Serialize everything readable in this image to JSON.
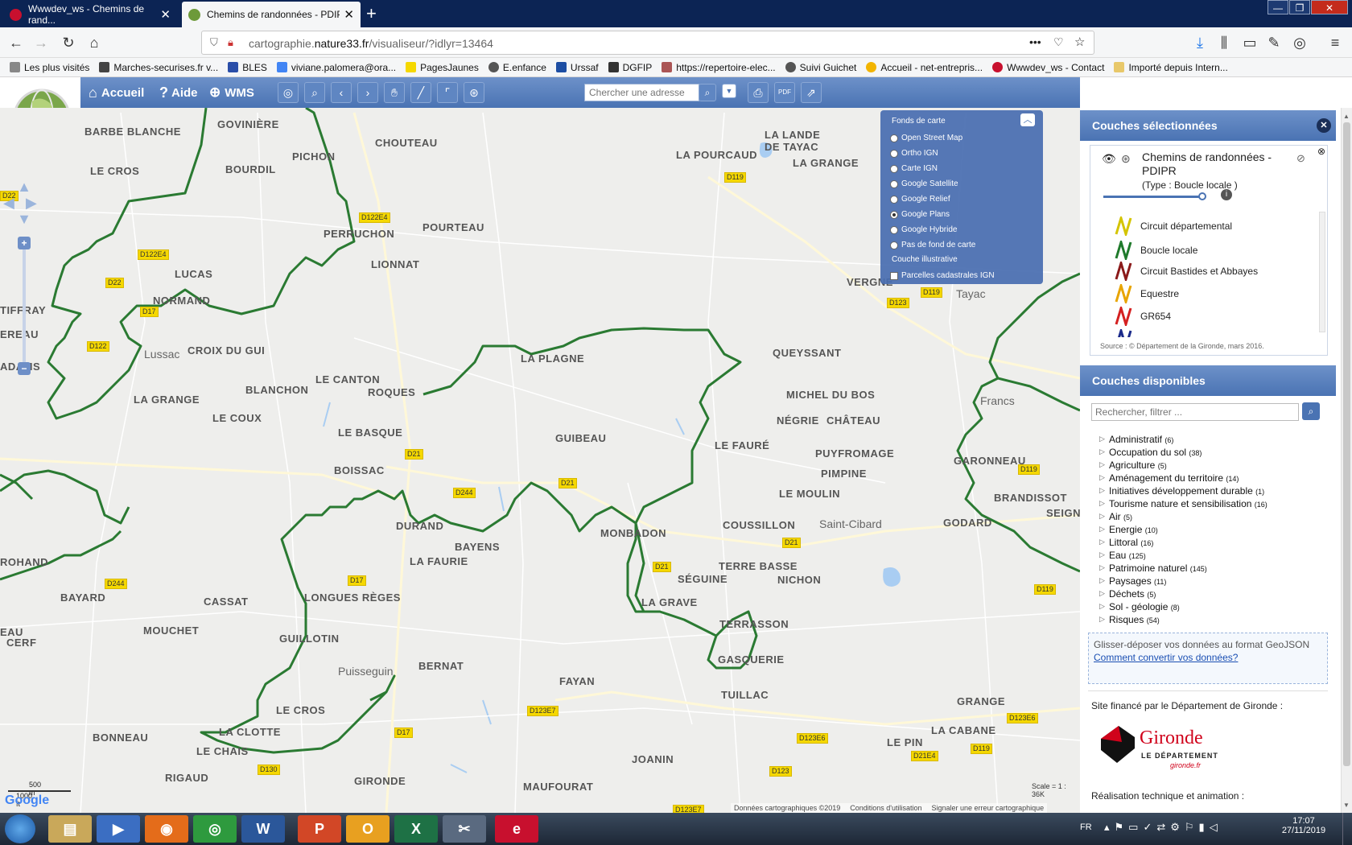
{
  "browser": {
    "tabs": [
      {
        "label": "Wwwdev_ws - Chemins de rand...",
        "active": false
      },
      {
        "label": "Chemins de randonnées - PDIP",
        "active": true
      }
    ],
    "url_prefix": "cartographie.",
    "url_domain": "nature33.fr",
    "url_path": "/visualiseur/?idlyr=13464",
    "bookmarks": [
      "Les plus visités",
      "Marches-securises.fr v...",
      "BLES",
      "viviane.palomera@ora...",
      "PagesJaunes",
      "E.enfance",
      "Urssaf",
      "DGFIP",
      "https://repertoire-elec...",
      "Suivi Guichet",
      "Accueil - net-entrepris...",
      "Wwwdev_ws - Contact",
      "Importé depuis Intern..."
    ]
  },
  "toolbar": {
    "home": "Accueil",
    "help": "Aide",
    "wms": "WMS",
    "search_placeholder": "Chercher une adresse"
  },
  "basemaps": {
    "title": "Fonds de carte",
    "options": [
      {
        "label": "Open Street Map",
        "selected": false
      },
      {
        "label": "Ortho IGN",
        "selected": false
      },
      {
        "label": "Carte IGN",
        "selected": false
      },
      {
        "label": "Google Satellite",
        "selected": false
      },
      {
        "label": "Google Relief",
        "selected": false
      },
      {
        "label": "Google Plans",
        "selected": true
      },
      {
        "label": "Google Hybride",
        "selected": false
      },
      {
        "label": "Pas de fond de carte",
        "selected": false
      }
    ],
    "illustrative_title": "Couche illustrative",
    "illustrative": [
      {
        "label": "Parcelles cadastrales IGN",
        "checked": false
      }
    ]
  },
  "map": {
    "places": [
      {
        "name": "BARBE BLANCHE"
      },
      {
        "name": "GOVINIÈRE"
      },
      {
        "name": "CHOUTEAU"
      },
      {
        "name": "LA LANDE"
      },
      {
        "name": "DE TAYAC"
      },
      {
        "name": "LA POURCAUD"
      },
      {
        "name": "LA GRANGE"
      },
      {
        "name": "LE CROS"
      },
      {
        "name": "BOURDIL"
      },
      {
        "name": "PICHON"
      },
      {
        "name": "PERRUCHON"
      },
      {
        "name": "POURTEAU"
      },
      {
        "name": "LUCAS"
      },
      {
        "name": "LIONNAT"
      },
      {
        "name": "VERGNE"
      },
      {
        "name": "NORMAND"
      },
      {
        "name": "Lussac",
        "town": true
      },
      {
        "name": "CROIX DU GUI"
      },
      {
        "name": "LA PLAGNE"
      },
      {
        "name": "QUEYSSANT"
      },
      {
        "name": "Tayac",
        "town": true
      },
      {
        "name": "LE CANTON"
      },
      {
        "name": "BLANCHON"
      },
      {
        "name": "ROQUES"
      },
      {
        "name": "MICHEL DU BOS"
      },
      {
        "name": "LA GRANGE"
      },
      {
        "name": "Francs",
        "town": true
      },
      {
        "name": "LE COUX"
      },
      {
        "name": "NÉGRIE"
      },
      {
        "name": "LE BASQUE"
      },
      {
        "name": "GUIBEAU"
      },
      {
        "name": "LE FAURÉ"
      },
      {
        "name": "CHÂTEAU"
      },
      {
        "name": "PUYFROMAGE"
      },
      {
        "name": "GARONNEAU"
      },
      {
        "name": "BOISSAC"
      },
      {
        "name": "PIMPINE"
      },
      {
        "name": "BRANDISSOT"
      },
      {
        "name": "SEIGNA"
      },
      {
        "name": "LE MOULIN"
      },
      {
        "name": "DURAND"
      },
      {
        "name": "MONBADON"
      },
      {
        "name": "COUSSILLON"
      },
      {
        "name": "Saint-Cibard",
        "town": true
      },
      {
        "name": "GODARD"
      },
      {
        "name": "BAYENS"
      },
      {
        "name": "ROHAND"
      },
      {
        "name": "LA FAURIE"
      },
      {
        "name": "TERRE BASSE"
      },
      {
        "name": "SÉGUINE"
      },
      {
        "name": "NICHON"
      },
      {
        "name": "BAYARD"
      },
      {
        "name": "CASSAT"
      },
      {
        "name": "LONGUES RÈGES"
      },
      {
        "name": "LA GRAVE"
      },
      {
        "name": "MOUCHET"
      },
      {
        "name": "TERRASSON"
      },
      {
        "name": "GUILLOTIN"
      },
      {
        "name": "EAU"
      },
      {
        "name": "CERF"
      },
      {
        "name": "GASQUERIE"
      },
      {
        "name": "Puisseguin",
        "town": true
      },
      {
        "name": "BERNAT"
      },
      {
        "name": "FAYAN"
      },
      {
        "name": "TUILLAC"
      },
      {
        "name": "GRANGE"
      },
      {
        "name": "LE CROS"
      },
      {
        "name": "LA CABANE"
      },
      {
        "name": "BONNEAU"
      },
      {
        "name": "LA CLOTTE"
      },
      {
        "name": "LE CHAIS"
      },
      {
        "name": "LE PIN"
      },
      {
        "name": "JOANIN"
      },
      {
        "name": "RIGAUD"
      },
      {
        "name": "GIRONDE"
      },
      {
        "name": "MAUFOURAT"
      },
      {
        "name": "TIFFRAY"
      },
      {
        "name": "EREAU"
      },
      {
        "name": "ADAMS"
      }
    ],
    "roads": [
      "D22",
      "D122E4",
      "D119",
      "D122E4",
      "D22",
      "D17",
      "D122",
      "D123",
      "D119",
      "D21",
      "D244",
      "D21",
      "D119",
      "D21",
      "D17",
      "D21",
      "D244",
      "D119",
      "D123E7",
      "D17",
      "D123E6",
      "D123E6",
      "D130",
      "D21E4",
      "D119",
      "D123",
      "D123E7"
    ],
    "scale_m": "500 m",
    "scale_ft": "1000 ft",
    "scale_ratio": "Scale = 1 : 36K",
    "attribution": "Données cartographiques ©2019",
    "terms": "Conditions d'utilisation",
    "report": "Signaler une erreur cartographique",
    "google": "Google"
  },
  "panel": {
    "selected_title": "Couches sélectionnées",
    "layer_name": "Chemins de randonnées - PDIPR",
    "layer_type": "(Type : Boucle locale )",
    "opacity": 0.95,
    "legend": [
      {
        "label": "Circuit départemental",
        "color": "#d4c400"
      },
      {
        "label": "Boucle locale",
        "color": "#1f7a2b"
      },
      {
        "label": "Circuit  Bastides et Abbayes",
        "color": "#8b1a1a"
      },
      {
        "label": "Equestre",
        "color": "#e8a400"
      },
      {
        "label": "GR654",
        "color": "#d42020"
      },
      {
        "label": "",
        "color": "#1a2a8a"
      }
    ],
    "source": "Source : © Département de la Gironde, mars 2016.",
    "available_title": "Couches disponibles",
    "filter_placeholder": "Rechercher, filtrer ...",
    "categories": [
      {
        "name": "Administratif",
        "count": "(6)"
      },
      {
        "name": "Occupation du sol",
        "count": "(38)"
      },
      {
        "name": "Agriculture",
        "count": "(5)"
      },
      {
        "name": "Aménagement du territoire",
        "count": "(14)"
      },
      {
        "name": "Initiatives développement durable",
        "count": "(1)"
      },
      {
        "name": "Tourisme nature et sensibilisation",
        "count": "(16)"
      },
      {
        "name": "Air",
        "count": "(5)"
      },
      {
        "name": "Energie",
        "count": "(10)"
      },
      {
        "name": "Littoral",
        "count": "(16)"
      },
      {
        "name": "Eau",
        "count": "(125)"
      },
      {
        "name": "Patrimoine naturel",
        "count": "(145)"
      },
      {
        "name": "Paysages",
        "count": "(11)"
      },
      {
        "name": "Déchets",
        "count": "(5)"
      },
      {
        "name": "Sol - géologie",
        "count": "(8)"
      },
      {
        "name": "Risques",
        "count": "(54)"
      }
    ],
    "dropzone_text": "Glisser-déposer vos données au format GeoJSON",
    "dropzone_link": "Comment convertir vos données?",
    "funding": "Site financé par le Département de Gironde :",
    "gironde_name": "Gironde",
    "gironde_sub": "LE DÉPARTEMENT",
    "gironde_url": "gironde.fr",
    "realisation": "Réalisation technique et animation :"
  },
  "taskbar": {
    "lang": "FR",
    "time": "17:07",
    "date": "27/11/2019"
  }
}
